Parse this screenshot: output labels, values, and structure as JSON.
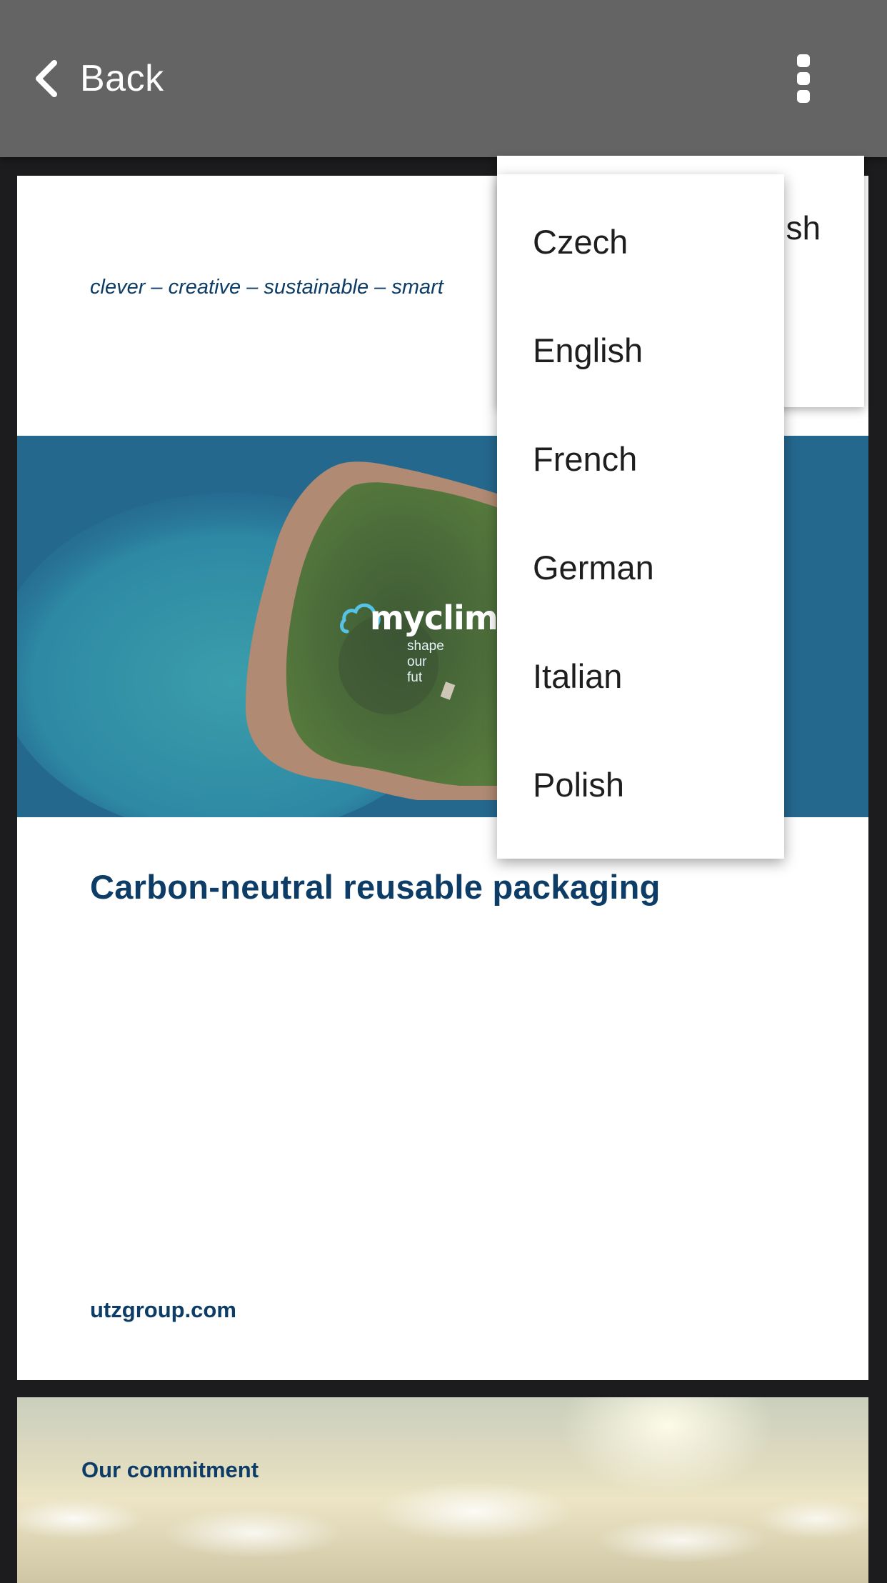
{
  "topbar": {
    "back_label": "Back",
    "back_icon": "chevron-left-icon",
    "more_icon": "more-vertical-icon",
    "background_color": "#646464"
  },
  "page1": {
    "tagline": "clever – creative – sustainable – smart",
    "hero_logo": {
      "word": "myclimat",
      "slogan": "shape our fut"
    },
    "headline": "Carbon-neutral reusable packaging",
    "site_link": "utzgroup.com",
    "accent_color": "#0d3d66"
  },
  "page2": {
    "heading": "Our commitment"
  },
  "language_menu_back": {
    "partial_label": "lish"
  },
  "language_menu": {
    "items": [
      {
        "label": "Czech"
      },
      {
        "label": "English"
      },
      {
        "label": "French"
      },
      {
        "label": "German"
      },
      {
        "label": "Italian"
      },
      {
        "label": "Polish"
      }
    ]
  }
}
